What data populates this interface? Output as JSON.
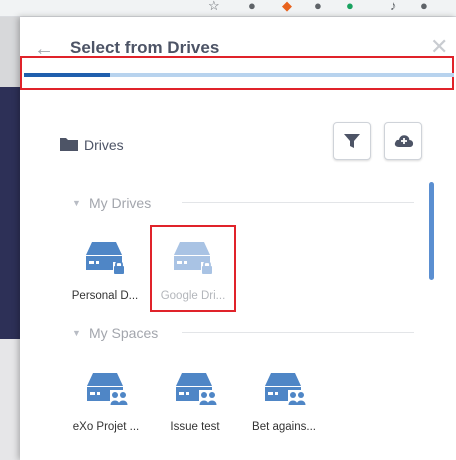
{
  "drawer": {
    "title": "Select from Drives",
    "progress": 0.2
  },
  "drives_header": {
    "label": "Drives"
  },
  "sections": [
    {
      "label": "My Drives",
      "items": [
        {
          "label": "Personal D...",
          "icon": "drive-lock-icon",
          "disabled": false
        },
        {
          "label": "Google Dri...",
          "icon": "drive-lock-icon",
          "disabled": true
        }
      ]
    },
    {
      "label": "My Spaces",
      "items": [
        {
          "label": "eXo Projet ...",
          "icon": "drive-group-icon"
        },
        {
          "label": "Issue test",
          "icon": "drive-group-icon"
        },
        {
          "label": "Bet agains...",
          "icon": "drive-group-icon"
        }
      ]
    }
  ],
  "colors": {
    "accent": "#1f5fad",
    "drive_blue": "#4f86c6",
    "drive_disabled": "#a9c3e4",
    "highlight_red": "#e0232a"
  }
}
